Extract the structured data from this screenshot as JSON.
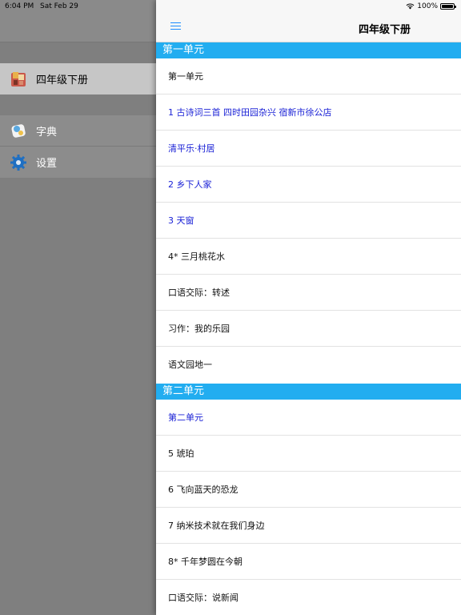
{
  "status_bar": {
    "time": "6:04 PM",
    "date": "Sat Feb 29",
    "battery": "100%",
    "wifi_icon": "wifi-icon"
  },
  "sidebar": {
    "items": [
      {
        "label": "四年级下册",
        "icon": "book-icon"
      },
      {
        "label": "字典",
        "icon": "dictionary-icon"
      },
      {
        "label": "设置",
        "icon": "gear-icon"
      }
    ]
  },
  "navbar": {
    "title": "四年级下册",
    "menu_icon": "menu-icon"
  },
  "sections": [
    {
      "title": "第一单元",
      "rows": [
        {
          "label": "第一单元",
          "color": "#111111"
        },
        {
          "label": "1 古诗词三首  四时田园杂兴  宿新市徐公店",
          "color": "#1b22d6"
        },
        {
          "label": " 清平乐·村居",
          "color": "#1b22d6"
        },
        {
          "label": "2 乡下人家",
          "color": "#1b22d6"
        },
        {
          "label": "3 天窗",
          "color": "#1b22d6"
        },
        {
          "label": "4* 三月桃花水",
          "color": "#111111"
        },
        {
          "label": "口语交际：转述",
          "color": "#111111"
        },
        {
          "label": "习作：我的乐园",
          "color": "#111111"
        },
        {
          "label": "语文园地一",
          "color": "#111111"
        }
      ]
    },
    {
      "title": "第二单元",
      "rows": [
        {
          "label": "第二单元",
          "color": "#1b22d6"
        },
        {
          "label": "5 琥珀",
          "color": "#111111"
        },
        {
          "label": "6 飞向蓝天的恐龙",
          "color": "#111111"
        },
        {
          "label": "7 纳米技术就在我们身边",
          "color": "#111111"
        },
        {
          "label": "8* 千年梦圆在今朝",
          "color": "#111111"
        },
        {
          "label": "口语交际：说新闻",
          "color": "#111111"
        }
      ]
    }
  ],
  "colors": {
    "section_header": "#22adf0",
    "link_blue": "#1b22d6",
    "accent": "#1a8cff"
  }
}
